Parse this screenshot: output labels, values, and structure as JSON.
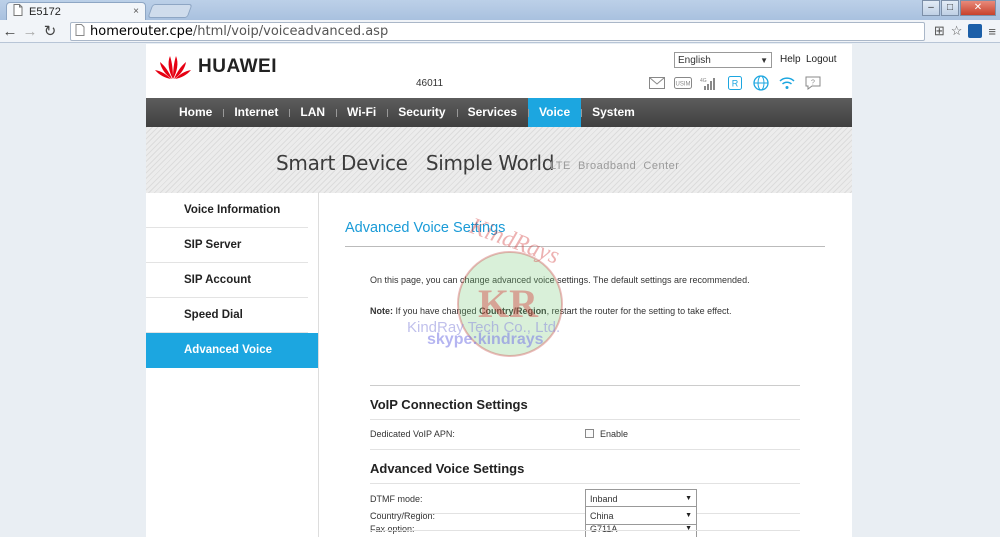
{
  "browser": {
    "tab_title": "E5172",
    "tab_close": "×",
    "url_host": "homerouter.cpe",
    "url_path": "/html/voip/voiceadvanced.asp",
    "window_controls": [
      "–",
      "□",
      "✕"
    ]
  },
  "header": {
    "brand": "HUAWEI",
    "model": "46011",
    "language": "English",
    "help": "Help",
    "logout": "Logout",
    "status_icons": [
      "mail-icon",
      "usim-icon",
      "signal-icon",
      "roaming-icon",
      "globe-icon",
      "wifi-icon",
      "help-icon"
    ]
  },
  "nav": {
    "items": [
      "Home",
      "Internet",
      "LAN",
      "Wi-Fi",
      "Security",
      "Services",
      "Voice",
      "System"
    ],
    "active": "Voice"
  },
  "banner": {
    "slogan": "Smart Device   Simple World",
    "sub": "LTE  Broadband  Center"
  },
  "sidebar": {
    "items": [
      "Voice Information",
      "SIP Server",
      "SIP Account",
      "Speed Dial",
      "Advanced Voice"
    ],
    "active": "Advanced Voice"
  },
  "content": {
    "title": "Advanced Voice Settings",
    "intro": "On this page, you can change advanced voice settings. The default settings are recommended.",
    "note_label": "Note:",
    "note_pre": " If you have changed ",
    "note_bold": "Country/Region",
    "note_post": ", restart the router for the setting to take effect.",
    "voip_section": {
      "title": "VoIP Connection Settings",
      "dedicated_apn_label": "Dedicated VoIP APN:",
      "dedicated_apn_option": "Enable",
      "dedicated_apn_checked": false
    },
    "advanced_section": {
      "title": "Advanced Voice Settings",
      "dtmf_label": "DTMF mode:",
      "dtmf_value": "Inband",
      "fax_label": "Fax option:",
      "fax_value": "G711A",
      "country_label": "Country/Region:",
      "country_value": "China"
    }
  },
  "watermark": {
    "line1": "KindRay Tech Co., Ltd.",
    "line2": "skype:kindrays",
    "logo_text": "KindRays",
    "logo_initials": "KR"
  },
  "colors": {
    "accent": "#1ca6e0",
    "nav_bg": "#4a4a4a",
    "huawei_red": "#e60012"
  }
}
